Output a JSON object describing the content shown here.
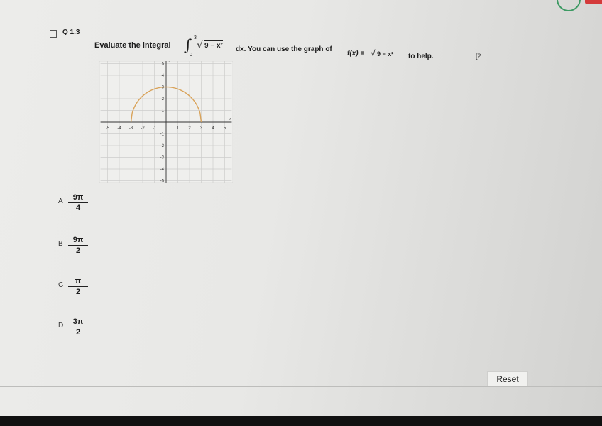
{
  "question": {
    "number": "Q 1.3",
    "points": "[2",
    "text_pre": "Evaluate the integral",
    "integral_upper": "3",
    "integral_lower": "0",
    "radical_symbol": "√",
    "integrand": "9 − x²",
    "text_mid": "dx. You can use the graph of",
    "function_label": "f(x) =",
    "function_radicand": "9 − x²",
    "text_post": "to help."
  },
  "graph": {
    "x_ticks": [
      "-5",
      "-4",
      "-3",
      "-2",
      "-1",
      "1",
      "2",
      "3",
      "4",
      "5"
    ],
    "y_ticks": [
      "5",
      "4",
      "3",
      "2",
      "1",
      "-1",
      "-2",
      "-3",
      "-4",
      "-5"
    ],
    "x_axis_label": "x",
    "y_axis_label": "y",
    "curve_color": "#d9a35a"
  },
  "choices": [
    {
      "letter": "A",
      "numerator": "9π",
      "denominator": "4"
    },
    {
      "letter": "B",
      "numerator": "9π",
      "denominator": "2"
    },
    {
      "letter": "C",
      "numerator": "π",
      "denominator": "2"
    },
    {
      "letter": "D",
      "numerator": "3π",
      "denominator": "2"
    }
  ],
  "reset_label": "Reset"
}
